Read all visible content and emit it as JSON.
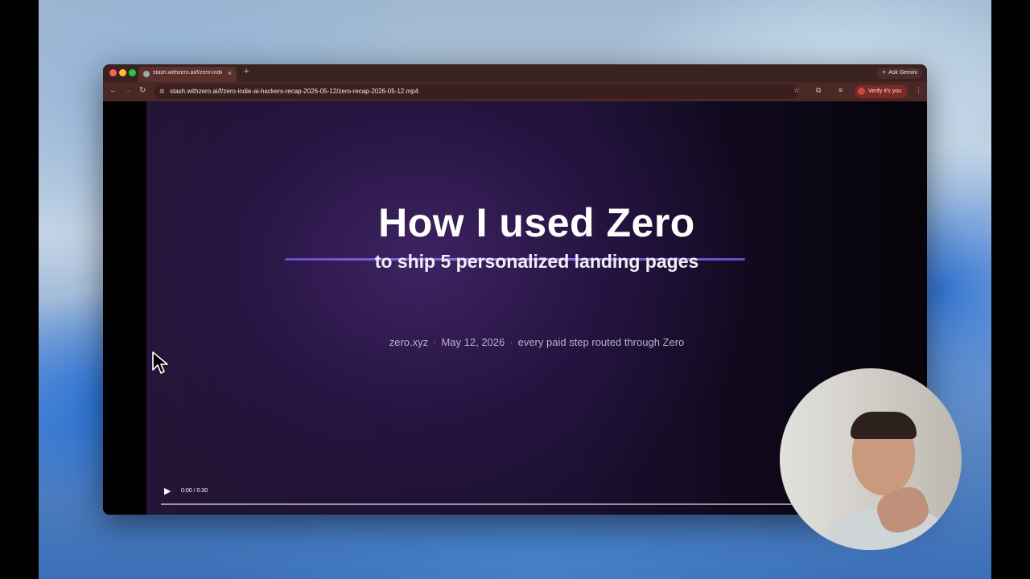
{
  "browser": {
    "tab": {
      "title": "stash.withzero.ai/f/zero-indie-ai-hackers-recap-2026-05-12/zero-recap-2026-05-12.mp4",
      "close": "×"
    },
    "new_tab": "+",
    "ask_gemini": "Ask Gemini",
    "url": "stash.withzero.ai/f/zero-indie-ai-hackers-recap-2026-05-12/zero-recap-2026-05-12.mp4",
    "verify": "Verify it's you"
  },
  "slide": {
    "title": "How I used Zero",
    "subtitle": "to ship 5 personalized landing pages",
    "meta": [
      "zero.xyz",
      "May 12, 2026",
      "every paid step routed through Zero"
    ],
    "separator": "·"
  },
  "player": {
    "time": "0:00 / 0:30",
    "progress": 0.0
  },
  "colors": {
    "accent_line": "#8a68e6",
    "tab_bar": "#3a2221",
    "toolbar": "#4a2826",
    "verify_badge": "#7a2a25"
  },
  "icons": [
    "back-arrow-icon",
    "forward-arrow-icon",
    "reload-icon",
    "site-info-icon",
    "bookmark-star-icon",
    "play-icon",
    "mouse-cursor-icon"
  ]
}
